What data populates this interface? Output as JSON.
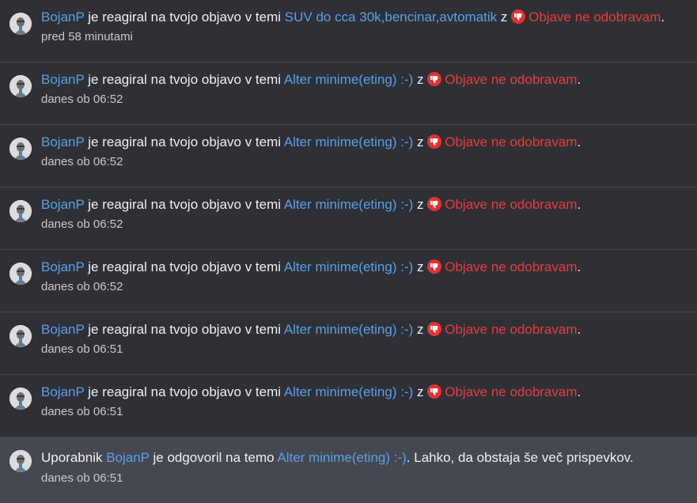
{
  "notifications": [
    {
      "user": "BojanP",
      "action": "je reagiral na tvojo objavo v temi",
      "topic": "SUV do cca 30k,bencinar,avtomatik",
      "z": "z",
      "reaction": "Objave ne odobravam",
      "end": ".",
      "time": "pred 58 minutami"
    },
    {
      "user": "BojanP",
      "action": "je reagiral na tvojo objavo v temi",
      "topic": "Alter minime(eting) :-)",
      "z": "z",
      "reaction": "Objave ne odobravam",
      "end": ".",
      "time": "danes ob 06:52"
    },
    {
      "user": "BojanP",
      "action": "je reagiral na tvojo objavo v temi",
      "topic": "Alter minime(eting) :-)",
      "z": "z",
      "reaction": "Objave ne odobravam",
      "end": ".",
      "time": "danes ob 06:52"
    },
    {
      "user": "BojanP",
      "action": "je reagiral na tvojo objavo v temi",
      "topic": "Alter minime(eting) :-)",
      "z": "z",
      "reaction": "Objave ne odobravam",
      "end": ".",
      "time": "danes ob 06:52"
    },
    {
      "user": "BojanP",
      "action": "je reagiral na tvojo objavo v temi",
      "topic": "Alter minime(eting) :-)",
      "z": "z",
      "reaction": "Objave ne odobravam",
      "end": ".",
      "time": "danes ob 06:52"
    },
    {
      "user": "BojanP",
      "action": "je reagiral na tvojo objavo v temi",
      "topic": "Alter minime(eting) :-)",
      "z": "z",
      "reaction": "Objave ne odobravam",
      "end": ".",
      "time": "danes ob 06:51"
    },
    {
      "user": "BojanP",
      "action": "je reagiral na tvojo objavo v temi",
      "topic": "Alter minime(eting) :-)",
      "z": "z",
      "reaction": "Objave ne odobravam",
      "end": ".",
      "time": "danes ob 06:51"
    }
  ],
  "reply": {
    "prefix": "Uporabnik",
    "user": "BojanP",
    "action": "je odgovoril na temo",
    "topic": "Alter minime(eting) :-)",
    "rest": ". Lahko, da obstaja še več prispevkov.",
    "time": "danes ob 06:51"
  },
  "colors": {
    "link": "#5aa0e6",
    "reaction_red": "#ea3b3b",
    "background": "#2e3036",
    "highlight": "#454850"
  },
  "icons": {
    "avatar": "user-avatar-icon",
    "reaction": "thumbs-down-icon"
  }
}
